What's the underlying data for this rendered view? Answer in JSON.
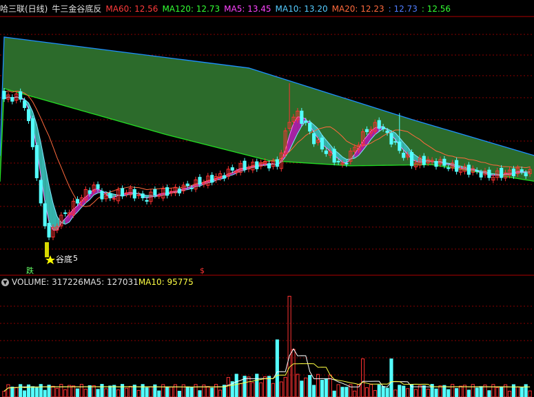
{
  "header": {
    "stock_name": "哈三联(日线)",
    "indicator_name": "牛三金谷底反",
    "items": [
      {
        "label": "MA60:",
        "value": "12.56",
        "color": "#ff3b3b"
      },
      {
        "label": "MA120:",
        "value": "12.73",
        "color": "#33ff33"
      },
      {
        "label": "MA5:",
        "value": "13.45",
        "color": "#ff44ff"
      },
      {
        "label": "MA10:",
        "value": "13.20",
        "color": "#55ccff"
      },
      {
        "label": "MA20:",
        "value": "12.23",
        "color": "#ff6a3d"
      },
      {
        "label": ":",
        "value": "12.73",
        "color": "#4f7dff"
      },
      {
        "label": ":",
        "value": "12.56",
        "color": "#33ff33"
      }
    ]
  },
  "volume_header": {
    "volume_label": "VOLUME:",
    "volume_value": "317226",
    "ma5_label": "MA5:",
    "ma5_value": "127031",
    "ma10_label": "MA10:",
    "ma10_value": "95775"
  },
  "annotations": {
    "star_label": "谷底",
    "star_icon": "star-icon",
    "low_price_label": "5",
    "signal_label": "跌",
    "marker_label": "$"
  },
  "colors": {
    "up": "#ff3232",
    "down": "#54ffff",
    "grid": "#8b0000",
    "band_fill": "#2c6b2b",
    "upper_line": "#1e90ff",
    "lower_line": "#22dd22",
    "ma20": "#ff6a3d",
    "cloud_teal": "#36b3ab",
    "cloud_magenta": "#a322a3",
    "vol_ma5": "#ffffff",
    "vol_ma10": "#ffff44"
  },
  "chart_data": {
    "type": "candlestick",
    "title": "牛三金谷底反",
    "candle_count": 130,
    "band_upper": [
      [
        0,
        14.9
      ],
      [
        60,
        14.3
      ],
      [
        100,
        13.3
      ],
      [
        130,
        12.6
      ]
    ],
    "band_lower": [
      [
        0,
        13.9
      ],
      [
        40,
        13.0
      ],
      [
        65,
        12.5
      ],
      [
        85,
        12.4
      ],
      [
        105,
        12.42
      ],
      [
        130,
        12.1
      ]
    ],
    "volume_ylim": [
      0,
      340000
    ]
  }
}
